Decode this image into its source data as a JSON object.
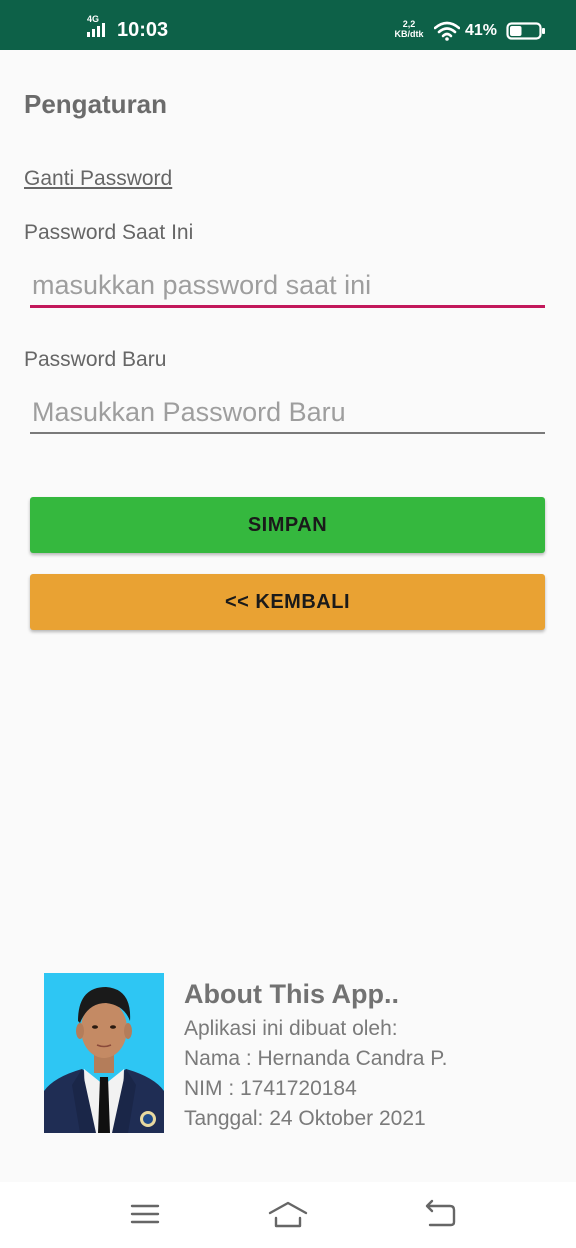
{
  "status_bar": {
    "network_type": "4G",
    "time": "10:03",
    "speed_value": "2,2",
    "speed_unit": "KB/dtk",
    "battery_percent": "41%",
    "battery_level": 0.41,
    "icons": [
      "signal-icon",
      "wifi-icon",
      "battery-icon"
    ]
  },
  "page": {
    "title": "Pengaturan",
    "section": "Ganti Password"
  },
  "form": {
    "current_password": {
      "label": "Password Saat Ini",
      "placeholder": "masukkan password saat ini",
      "value": ""
    },
    "new_password": {
      "label": "Password Baru",
      "placeholder": "Masukkan Password Baru",
      "value": ""
    },
    "save_label": "SIMPAN",
    "back_label": "<< KEMBALI"
  },
  "about": {
    "title": "About This App..",
    "line1": "Aplikasi ini dibuat oleh:",
    "line2": "Nama : Hernanda Candra P.",
    "line3": "NIM : 1741720184",
    "line4": "Tanggal: 24 Oktober 2021"
  },
  "nav": {
    "icons": [
      "menu-icon",
      "home-icon",
      "back-icon"
    ]
  },
  "colors": {
    "status_bar": "#0d6148",
    "accent_underline": "#c2185b",
    "save_button": "#35b83e",
    "back_button": "#e9a233",
    "photo_background": "#2ec6f3"
  }
}
